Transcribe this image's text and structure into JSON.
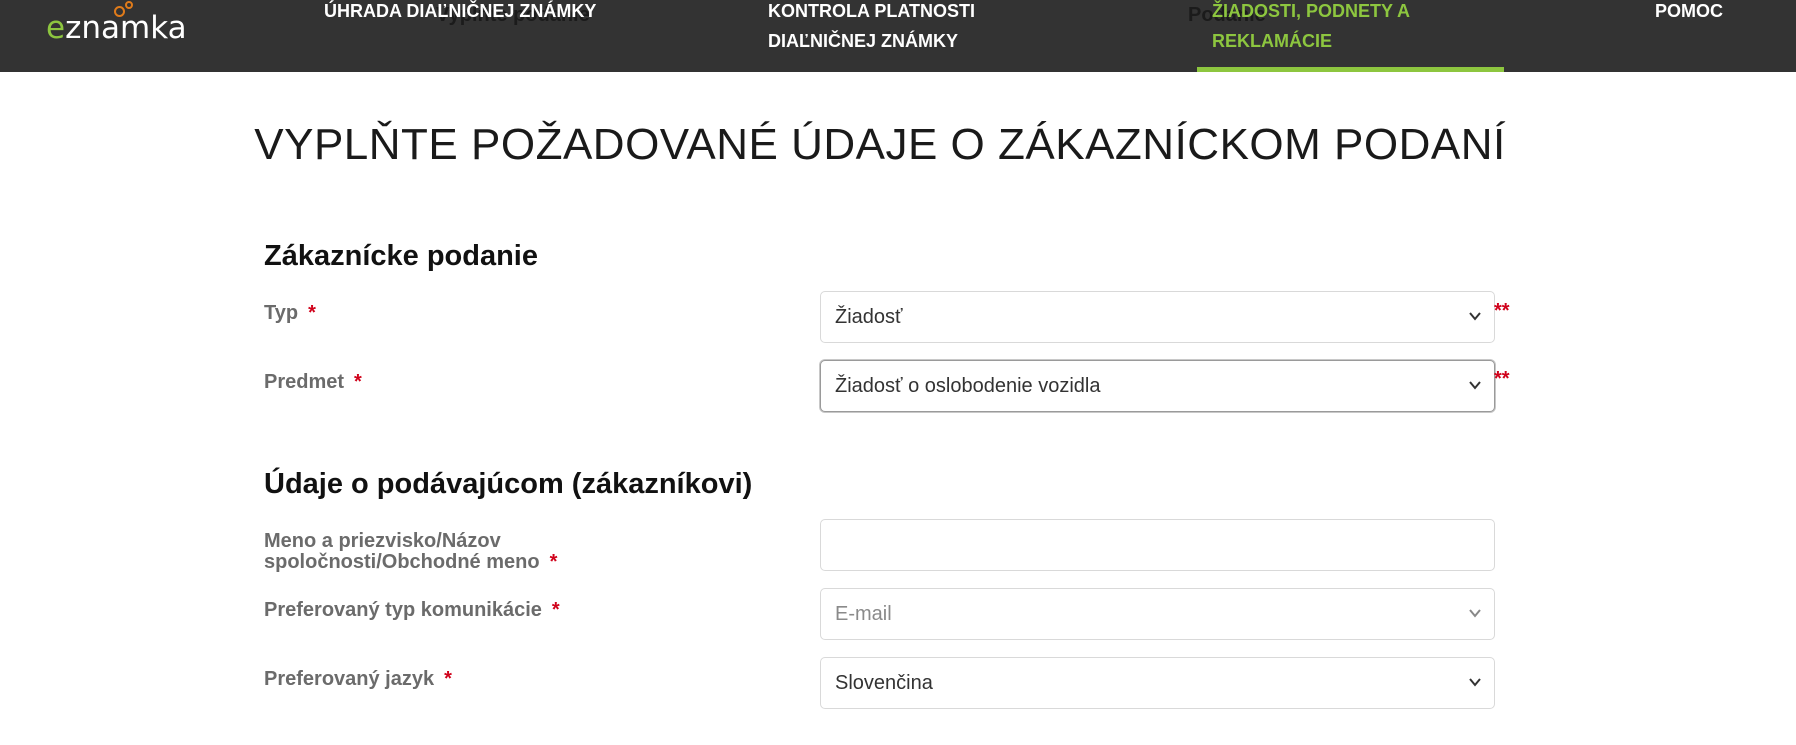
{
  "logo": {
    "text_e": "e",
    "text_rest": "znamka"
  },
  "ghost_text": {
    "left": "Vyplňte podanie",
    "right": "Podanie"
  },
  "nav": [
    {
      "line1": "ÚHRADA DIAĽNIČNEJ ZNÁMKY",
      "line2": ""
    },
    {
      "line1": "KONTROLA PLATNOSTI",
      "line2": "DIAĽNIČNEJ ZNÁMKY"
    },
    {
      "line1": "ŽIADOSTI, PODNETY A",
      "line2": "REKLAMÁCIE",
      "active": true
    },
    {
      "line1": "POMOC",
      "line2": ""
    }
  ],
  "heading": "VYPLŇTE POŽADOVANÉ ÚDAJE O ZÁKAZNÍCKOM PODANÍ",
  "sections": {
    "podanie": {
      "title": "Zákaznícke podanie",
      "typ_label": "Typ",
      "typ_value": "Žiadosť",
      "predmet_label": "Predmet",
      "predmet_value": "Žiadosť o oslobodenie vozidla"
    },
    "podavajuci": {
      "title": "Údaje o podávajúcom (zákazníkovi)",
      "meno_label_1": "Meno a priezvisko/Názov",
      "meno_label_2": "spoločnosti/Obchodné meno",
      "meno_value": "",
      "komunikacia_label": "Preferovaný typ komunikácie",
      "komunikacia_value": "E-mail",
      "jazyk_label": "Preferovaný jazyk",
      "jazyk_value": "Slovenčina"
    }
  },
  "required_mark": "*",
  "double_required_mark": "**",
  "colors": {
    "nav_bg": "#333333",
    "accent": "#8dc63f",
    "required": "#d0021b",
    "logo_ring": "#e07b1a"
  }
}
